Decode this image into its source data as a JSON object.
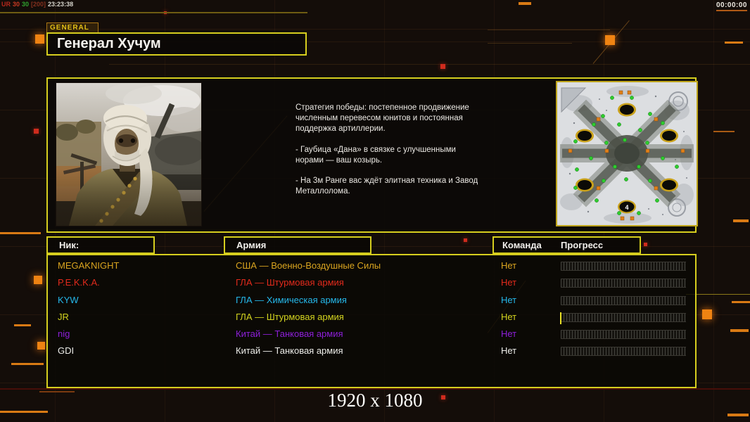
{
  "debug": {
    "parts": [
      {
        "text": "UR",
        "color": "#b5281c"
      },
      {
        "text": "30",
        "color": "#c93a22"
      },
      {
        "text": "30",
        "color": "#2fa32f"
      },
      {
        "text": "[200]",
        "color": "#84301e"
      },
      {
        "text": "23:23:38",
        "color": "#d8d6ce"
      }
    ]
  },
  "timer": {
    "value": "00:00:00"
  },
  "general_tab": {
    "label": "GENERAL"
  },
  "title": {
    "text": "Генерал Хучум"
  },
  "strategy": {
    "paragraphs": [
      "Стратегия победы: постепенное продвижение численным перевесом юнитов и постоянная поддержка артиллерии.",
      "- Гаубица «Дана» в связке с улучшенными норами — ваш козырь.",
      "- На 3м Ранге вас ждёт элитная техника и Завод Металлолома."
    ]
  },
  "map": {
    "start_marker_label": "4"
  },
  "table": {
    "headers": {
      "nick": "Ник:",
      "army": "Армия",
      "team": "Команда",
      "progress": "Прогресс"
    }
  },
  "players": [
    {
      "name": "MEGAKNIGHT",
      "army": "США — Военно-Воздушные Силы",
      "team": "Нет",
      "color": "#d9a41f",
      "progress": 0,
      "has_cursor": false
    },
    {
      "name": "P.E.K.K.A.",
      "army": "ГЛА — Штурмовая армия",
      "team": "Нет",
      "color": "#e22a1c",
      "progress": 0,
      "has_cursor": false
    },
    {
      "name": "KYW",
      "army": "ГЛА — Химическая армия",
      "team": "Нет",
      "color": "#25b8ea",
      "progress": 0,
      "has_cursor": false
    },
    {
      "name": "JR",
      "army": "ГЛА — Штурмовая армия",
      "team": "Нет",
      "color": "#d3d31f",
      "progress": 0,
      "has_cursor": true
    },
    {
      "name": "nig",
      "army": "Китай — Танковая армия",
      "team": "Нет",
      "color": "#8e1fd9",
      "progress": 0,
      "has_cursor": false
    },
    {
      "name": "GDI",
      "army": "Китай — Танковая армия",
      "team": "Нет",
      "color": "#eeeeea",
      "progress": 0,
      "has_cursor": false
    }
  ],
  "footer": {
    "resolution": "1920 x 1080"
  }
}
